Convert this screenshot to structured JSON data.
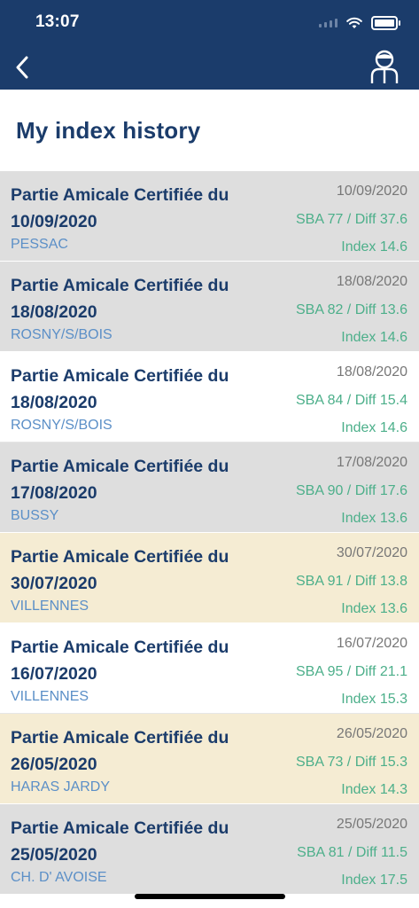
{
  "status_bar": {
    "time": "13:07"
  },
  "header": {
    "title": "My index history"
  },
  "rounds": [
    {
      "title_line1": "Partie Amicale Certifiée du",
      "title_line2": "10/09/2020",
      "place": "PESSAC",
      "date": "10/09/2020",
      "sba": "SBA 77 / Diff 37.6",
      "index": "Index 14.6",
      "tone": "gray"
    },
    {
      "title_line1": "Partie Amicale Certifiée du",
      "title_line2": "18/08/2020",
      "place": "ROSNY/S/BOIS",
      "date": "18/08/2020",
      "sba": "SBA 82 / Diff 13.6",
      "index": "Index 14.6",
      "tone": "gray"
    },
    {
      "title_line1": "Partie Amicale Certifiée du",
      "title_line2": "18/08/2020",
      "place": "ROSNY/S/BOIS",
      "date": "18/08/2020",
      "sba": "SBA 84 / Diff 15.4",
      "index": "Index 14.6",
      "tone": "white"
    },
    {
      "title_line1": "Partie Amicale Certifiée du",
      "title_line2": "17/08/2020",
      "place": "BUSSY",
      "date": "17/08/2020",
      "sba": "SBA 90 / Diff 17.6",
      "index": "Index 13.6",
      "tone": "gray"
    },
    {
      "title_line1": "Partie Amicale Certifiée du",
      "title_line2": "30/07/2020",
      "place": "VILLENNES",
      "date": "30/07/2020",
      "sba": "SBA 91 / Diff 13.8",
      "index": "Index 13.6",
      "tone": "cream"
    },
    {
      "title_line1": "Partie Amicale Certifiée du",
      "title_line2": "16/07/2020",
      "place": "VILLENNES",
      "date": "16/07/2020",
      "sba": "SBA 95 / Diff 21.1",
      "index": "Index 15.3",
      "tone": "white"
    },
    {
      "title_line1": "Partie Amicale Certifiée du",
      "title_line2": "26/05/2020",
      "place": "HARAS JARDY",
      "date": "26/05/2020",
      "sba": "SBA 73 / Diff 15.3",
      "index": "Index 14.3",
      "tone": "cream"
    },
    {
      "title_line1": "Partie Amicale Certifiée du",
      "title_line2": "25/05/2020",
      "place": "CH. D' AVOISE",
      "date": "25/05/2020",
      "sba": "SBA 81 / Diff 11.5",
      "index": "Index 17.5",
      "tone": "gray"
    }
  ],
  "icons": {
    "back": "chevron-left-icon",
    "profile": "golfer-profile-icon",
    "wifi": "wifi-icon",
    "battery": "battery-icon",
    "signal": "cellular-signal-icon"
  },
  "colors": {
    "navy": "#1b3c6b",
    "green": "#4caf8a",
    "place_blue": "#5b8fc7",
    "gray_row": "#dedede",
    "cream_row": "#f5ecd3"
  }
}
